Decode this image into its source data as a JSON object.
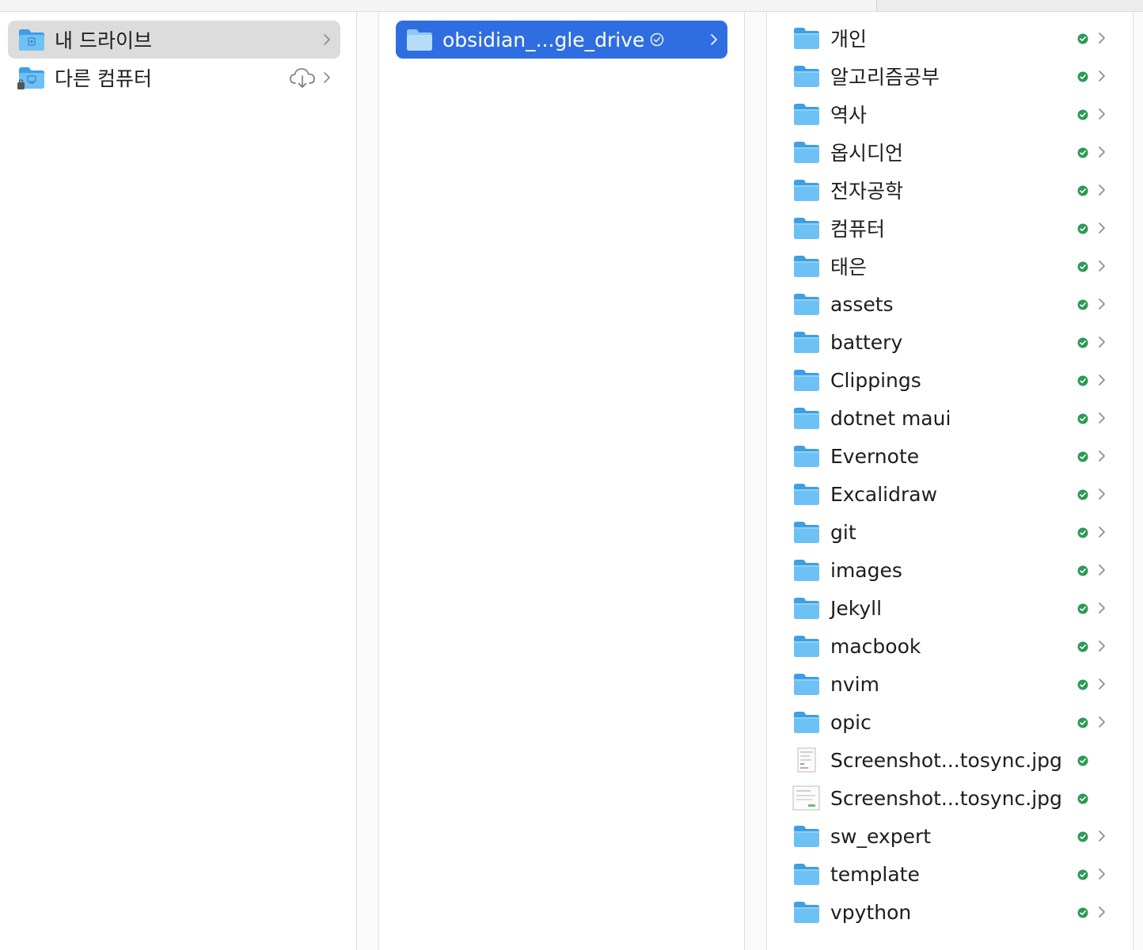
{
  "sidebar": {
    "items": [
      {
        "label": "내 드라이브",
        "icon": "drive-folder-icon",
        "selected": true
      },
      {
        "label": "다른 컴퓨터",
        "icon": "computer-folder-icon",
        "selected": false,
        "status_icon": "cloud-download-icon"
      }
    ]
  },
  "column2": {
    "items": [
      {
        "label": "obsidian_...gle_drive",
        "icon": "folder-icon",
        "status_icon": "synced-check-icon",
        "selected": true
      }
    ]
  },
  "column3": {
    "items": [
      {
        "label": "개인",
        "type": "folder"
      },
      {
        "label": "알고리즘공부",
        "type": "folder"
      },
      {
        "label": "역사",
        "type": "folder"
      },
      {
        "label": "옵시디언",
        "type": "folder"
      },
      {
        "label": "전자공학",
        "type": "folder"
      },
      {
        "label": "컴퓨터",
        "type": "folder"
      },
      {
        "label": "태은",
        "type": "folder"
      },
      {
        "label": "assets",
        "type": "folder"
      },
      {
        "label": "battery",
        "type": "folder"
      },
      {
        "label": "Clippings",
        "type": "folder"
      },
      {
        "label": "dotnet maui",
        "type": "folder"
      },
      {
        "label": "Evernote",
        "type": "folder"
      },
      {
        "label": "Excalidraw",
        "type": "folder"
      },
      {
        "label": "git",
        "type": "folder"
      },
      {
        "label": "images",
        "type": "folder"
      },
      {
        "label": "Jekyll",
        "type": "folder"
      },
      {
        "label": "macbook",
        "type": "folder"
      },
      {
        "label": "nvim",
        "type": "folder"
      },
      {
        "label": "opic",
        "type": "folder"
      },
      {
        "label": "Screenshot...tosync.jpg",
        "type": "file"
      },
      {
        "label": "Screenshot...tosync.jpg",
        "type": "file"
      },
      {
        "label": "sw_expert",
        "type": "folder"
      },
      {
        "label": "template",
        "type": "folder"
      },
      {
        "label": "vpython",
        "type": "folder"
      }
    ]
  },
  "colors": {
    "selection_blue": "#2f6ee0",
    "selection_gray": "#dcdcdc",
    "folder_blue": "#5fb6f0",
    "sync_green": "#2e9a55"
  }
}
